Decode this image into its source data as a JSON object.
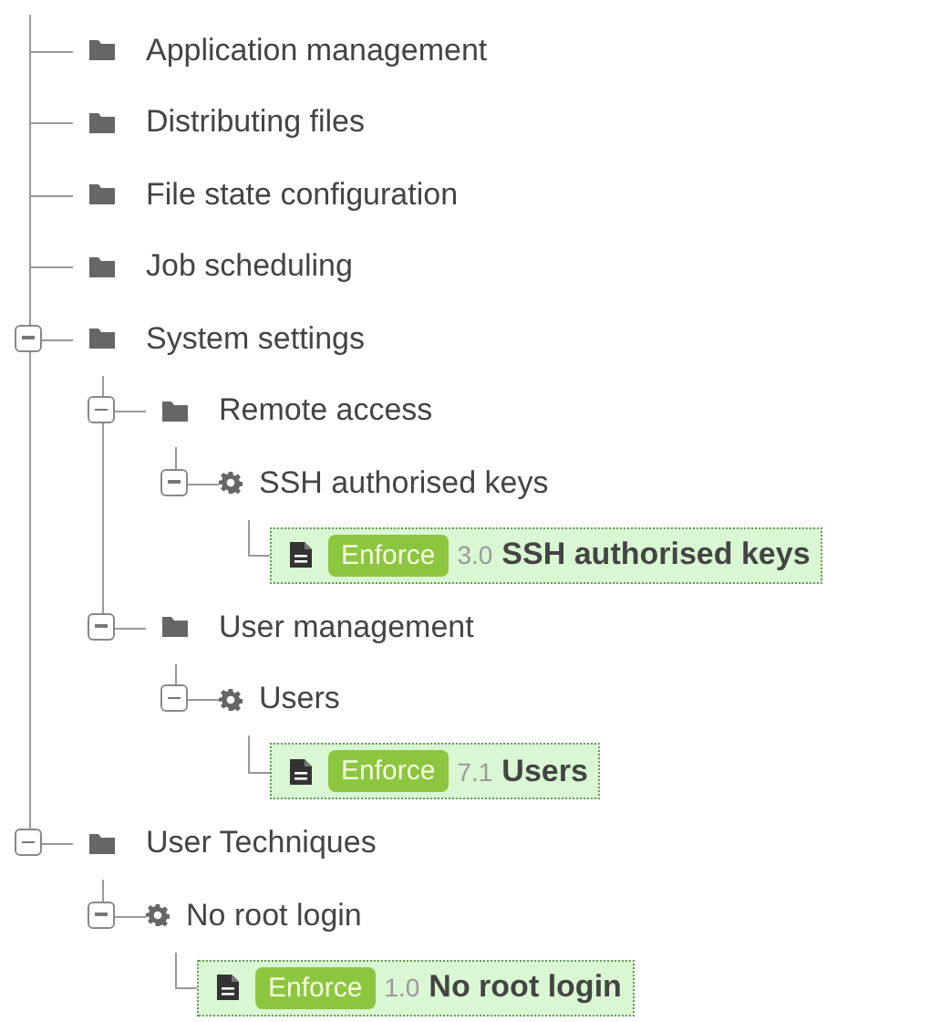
{
  "tree": [
    {
      "kind": "folder",
      "label": "Application management"
    },
    {
      "kind": "folder",
      "label": "Distributing files"
    },
    {
      "kind": "folder",
      "label": "File state configuration"
    },
    {
      "kind": "folder",
      "label": "Job scheduling"
    },
    {
      "kind": "folder",
      "label": "System settings",
      "expanded": true,
      "children": [
        {
          "kind": "folder",
          "label": "Remote access",
          "expanded": true,
          "children": [
            {
              "kind": "technique",
              "label": "SSH authorised keys",
              "expanded": true,
              "children": [
                {
                  "kind": "directive",
                  "badge": "Enforce",
                  "version": "3.0",
                  "label": "SSH authorised keys",
                  "highlighted": true
                }
              ]
            }
          ]
        },
        {
          "kind": "folder",
          "label": "User management",
          "expanded": true,
          "children": [
            {
              "kind": "technique",
              "label": "Users",
              "expanded": true,
              "children": [
                {
                  "kind": "directive",
                  "badge": "Enforce",
                  "version": "7.1",
                  "label": "Users",
                  "highlighted": true
                }
              ]
            }
          ]
        }
      ]
    },
    {
      "kind": "folder",
      "label": "User Techniques",
      "expanded": true,
      "children": [
        {
          "kind": "technique",
          "label": "No root login",
          "expanded": true,
          "children": [
            {
              "kind": "directive",
              "badge": "Enforce",
              "version": "1.0",
              "label": "No root login",
              "highlighted": true
            }
          ]
        }
      ]
    }
  ]
}
